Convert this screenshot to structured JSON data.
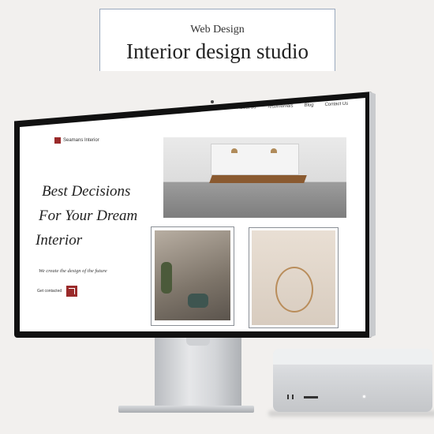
{
  "card": {
    "category": "Web Design",
    "title": "Interior design studio"
  },
  "site": {
    "logo_text": "Seamans Interior",
    "nav": [
      "Our services",
      "About us",
      "Testimonials",
      "Blog",
      "Contact Us"
    ],
    "hero_lines": [
      "Best Decisions",
      "For Your Dream",
      "Interior"
    ],
    "tagline": "We create the design of the future",
    "cta_label": "Get contacted"
  },
  "icons": {
    "logo": "logo-square-icon",
    "cta": "arrow-up-right-icon"
  },
  "colors": {
    "accent": "#9a2a2a",
    "background": "#f2f0ee",
    "frame": "#8a8f96"
  }
}
